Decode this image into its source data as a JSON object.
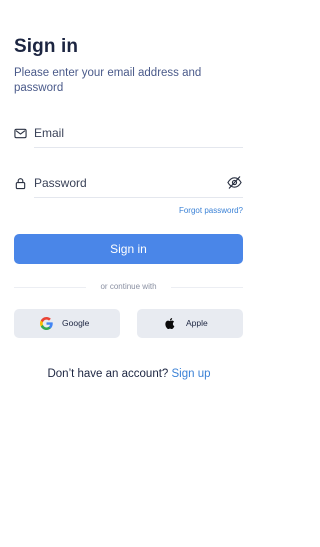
{
  "header": {
    "title": "Sign in",
    "subtitle": "Please enter your email address and password"
  },
  "form": {
    "email": {
      "placeholder": "Email",
      "icon": "envelope-icon"
    },
    "password": {
      "placeholder": "Password",
      "icon": "lock-icon",
      "toggle_icon": "eye-off-icon"
    },
    "forgot_label": "Forgot password?",
    "submit_label": "Sign in"
  },
  "divider": {
    "label": "or continue with"
  },
  "social": {
    "google_label": "Google",
    "apple_label": "Apple"
  },
  "footer": {
    "prompt": "Don’t have an account?",
    "signup_label": "Sign up"
  },
  "colors": {
    "accent": "#4a86e8",
    "link": "#3b82d6",
    "heading": "#1c2541",
    "social_bg": "#e8ebf1"
  }
}
